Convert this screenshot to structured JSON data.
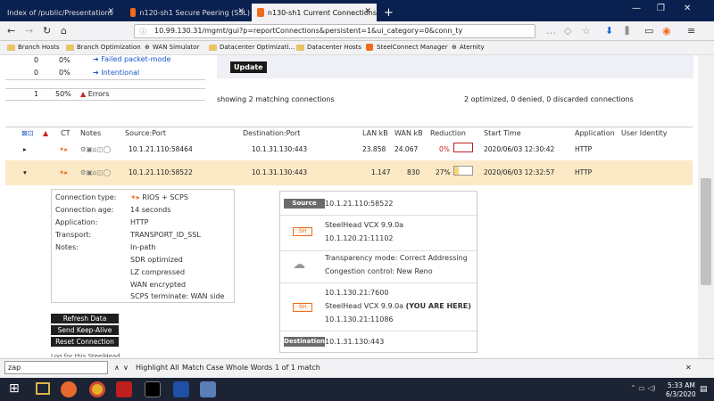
{
  "tabs": [
    {
      "label": "Index of /public/Presentations"
    },
    {
      "label": "n120-sh1 Secure Peering (SSL)"
    },
    {
      "label": "n130-sh1 Current Connections"
    }
  ],
  "new_tab": "+",
  "url": "10.99.130.31/mgmt/gui?p=reportConnections&persistent=1&ui_category=0&conn_ty",
  "bookmarks": [
    "Branch Hosts",
    "Branch Optimization",
    "WAN Simulator",
    "Datacenter Optimizati...",
    "Datacenter Hosts",
    "SteelConnect Manager",
    "Aternity"
  ],
  "summary": {
    "rows": [
      {
        "count": "0",
        "pct": "0%",
        "label": "Failed packet-mode"
      },
      {
        "count": "0",
        "pct": "0%",
        "label": "Intentional"
      },
      {
        "count": "1",
        "pct": "50%",
        "label": "Errors"
      }
    ],
    "update_label": "Update",
    "showing": "showing 2 matching connections",
    "totals": "2 optimized, 0 denied, 0 discarded connections"
  },
  "table": {
    "headers": [
      "CT",
      "Notes",
      "Source:Port",
      "Destination:Port",
      "LAN kB",
      "WAN kB",
      "Reduction",
      "Start Time",
      "Application",
      "User Identity"
    ],
    "rows": [
      {
        "source": "10.1.21.110:58464",
        "dest": "10.1.31.130:443",
        "lan": "23.858",
        "wan": "24.067",
        "reduction": "0%",
        "reduction_fraction": 0,
        "start": "2020/06/03 12:30:42",
        "app": "HTTP"
      },
      {
        "source": "10.1.21.110:58522",
        "dest": "10.1.31.130:443",
        "lan": "1.147",
        "wan": "830",
        "reduction": "27%",
        "reduction_fraction": 0.27,
        "start": "2020/06/03 12:32:57",
        "app": "HTTP"
      }
    ]
  },
  "details": {
    "labels": [
      "Connection type:",
      "Connection age:",
      "Application:",
      "Transport:",
      "Notes:"
    ],
    "values": [
      "RIOS + SCPS",
      "14 seconds",
      "HTTP",
      "TRANSPORT_ID_SSL"
    ],
    "notes": [
      "In-path",
      "SDR optimized",
      "LZ compressed",
      "WAN encrypted",
      "SCPS terminate: WAN side"
    ]
  },
  "buttons": [
    "Refresh Data",
    "Send Keep-Alive",
    "Reset Connection"
  ],
  "path": {
    "source_tag": "Source",
    "source": "10.1.21.110:58522",
    "sh_tag": "SH",
    "sh1_name": "SteelHead VCX 9.9.0a",
    "sh1_ip": "10.1.120.21:11102",
    "transparency": "Transparency mode: Correct Addressing",
    "congestion": "Congestion control: New Reno",
    "sh2_ip1": "10.1.130.21:7600",
    "sh2_name": "SteelHead VCX 9.9.0a",
    "you_are_here": "(YOU ARE HERE)",
    "sh2_ip2": "10.1.130.21:11086",
    "dest_tag": "Destination",
    "dest": "10.1.31.130:443"
  },
  "partial_text": "Log for this SteelHead",
  "find": {
    "value": "zap",
    "highlight_all": "Highlight All",
    "match_case": "Match Case",
    "whole_words": "Whole Words",
    "result": "1 of 1 match"
  },
  "clock": {
    "time": "5:33 AM",
    "date": "6/3/2020"
  }
}
